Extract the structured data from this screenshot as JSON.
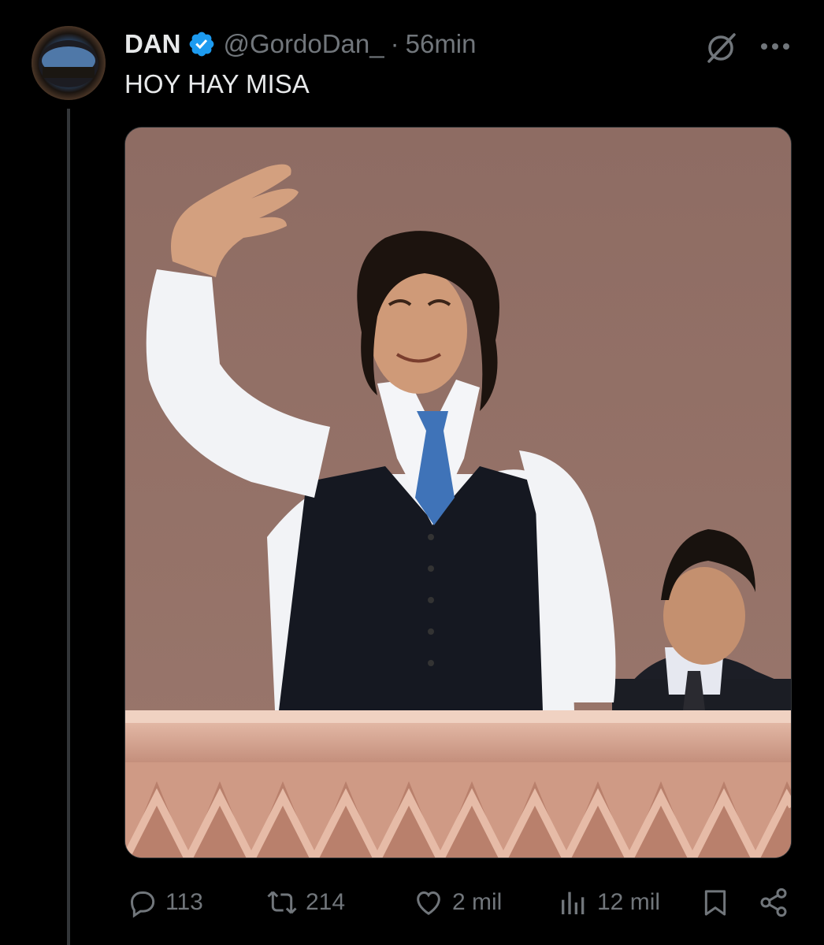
{
  "tweet": {
    "display_name": "DAN",
    "verified_icon": "verified-badge-icon",
    "handle": "@GordoDan_",
    "separator": "·",
    "time": "56min",
    "text": "HOY HAY MISA"
  },
  "toolbar": {
    "grok_icon": "grok-icon",
    "more_icon": "more-icon"
  },
  "media": {
    "description_icon": "photo"
  },
  "actions": {
    "replies": "113",
    "reposts": "214",
    "likes": "2 mil",
    "views": "12 mil"
  },
  "colors": {
    "background": "#000000",
    "text_primary": "#e7e9ea",
    "text_secondary": "#71767b",
    "verified_blue": "#1d9bf0",
    "thread_line": "#333639"
  }
}
